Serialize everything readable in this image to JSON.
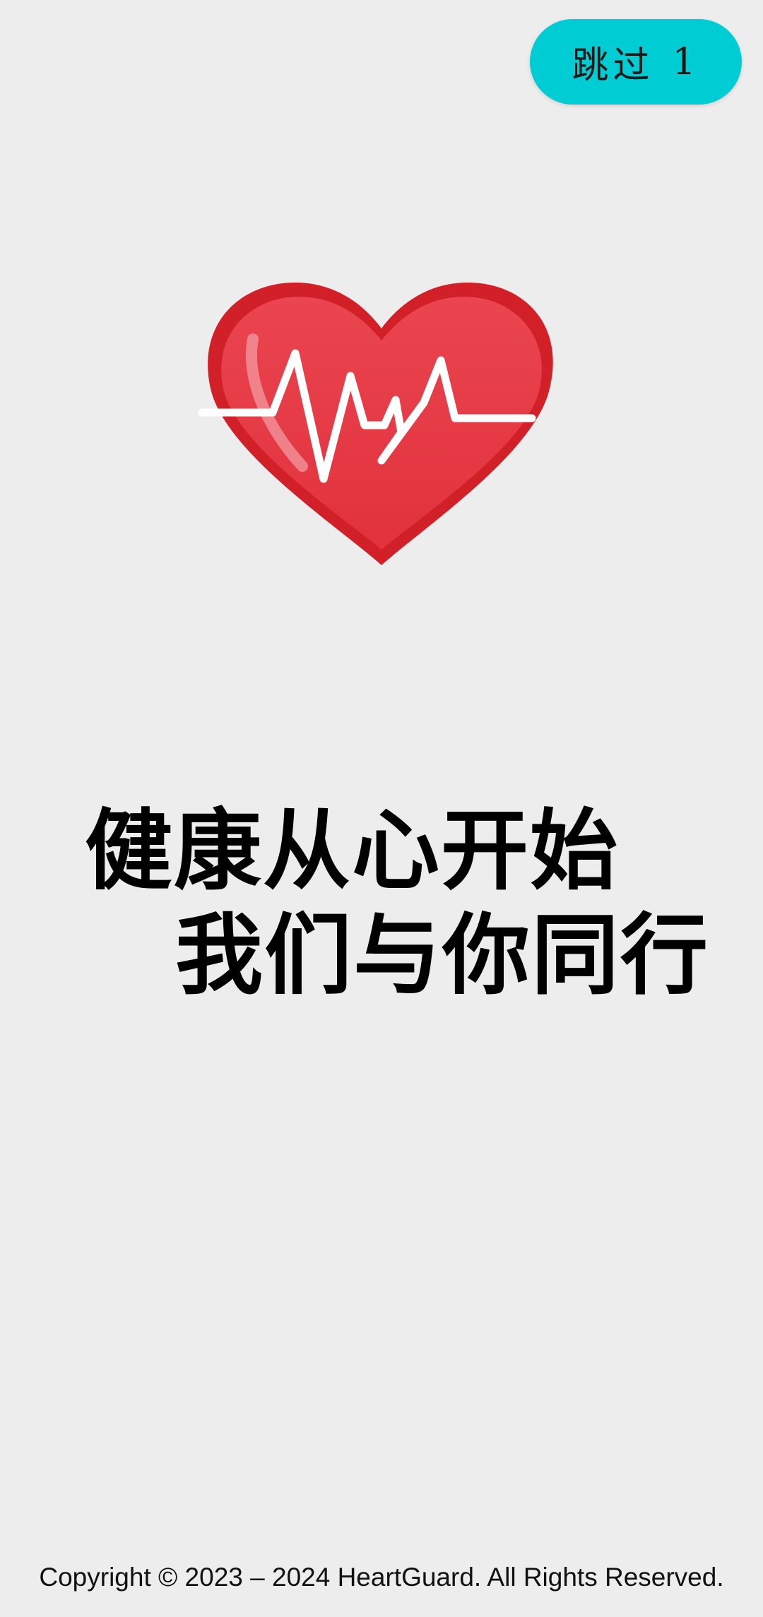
{
  "skip": {
    "label": "跳过",
    "countdown": "1"
  },
  "logo": {
    "icon": "heart-ecg-icon"
  },
  "slogan": {
    "line1": "健康从心开始",
    "line2": "我们与你同行"
  },
  "footer": {
    "copyright": "Copyright © 2023 – 2024 HeartGuard. All Rights Reserved."
  },
  "colors": {
    "background": "#ededee",
    "skip_button": "#00ccd3",
    "heart": "#e23a44"
  }
}
